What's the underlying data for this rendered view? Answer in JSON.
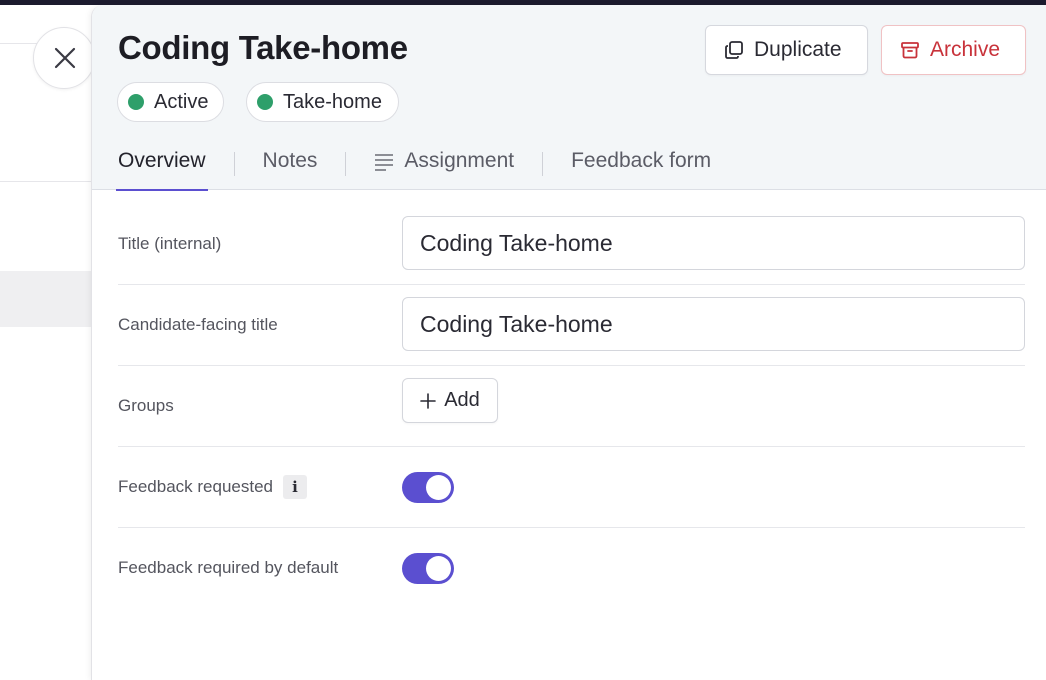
{
  "drawer": {
    "title": "Coding Take-home",
    "actions": {
      "duplicate_label": "Duplicate",
      "archive_label": "Archive"
    },
    "badges": [
      {
        "label": "Active",
        "color": "#2e9f6a"
      },
      {
        "label": "Take-home",
        "color": "#2e9f6a"
      }
    ],
    "tabs": [
      {
        "label": "Overview",
        "active": true
      },
      {
        "label": "Notes",
        "active": false
      },
      {
        "label": "Assignment",
        "active": false,
        "icon": "list-lines-icon"
      },
      {
        "label": "Feedback form",
        "active": false
      }
    ]
  },
  "form": {
    "title_internal": {
      "label": "Title (internal)",
      "value": "Coding Take-home"
    },
    "candidate_title": {
      "label": "Candidate-facing title",
      "value": "Coding Take-home"
    },
    "groups": {
      "label": "Groups",
      "add_label": "Add"
    },
    "feedback_requested": {
      "label": "Feedback requested",
      "info": "i",
      "enabled": true
    },
    "feedback_required": {
      "label": "Feedback required by default",
      "enabled": true
    }
  },
  "colors": {
    "accent": "#5b4fd0",
    "status_green": "#2e9f6a",
    "danger": "#c8323a"
  }
}
